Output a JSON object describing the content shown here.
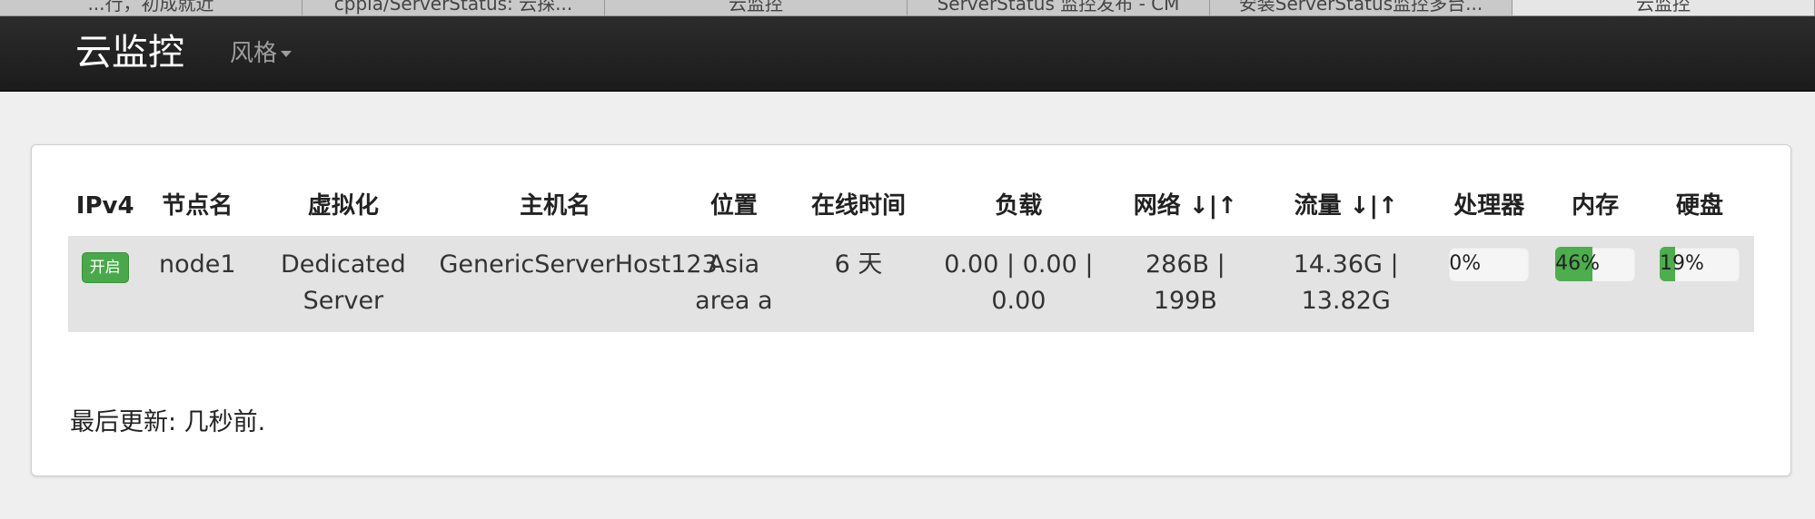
{
  "browser": {
    "tabs": [
      {
        "label": "...行，初成就近",
        "active": false
      },
      {
        "label": "cppla/ServerStatus: 云探...",
        "active": false
      },
      {
        "label": "云监控",
        "active": false
      },
      {
        "label": "ServerStatus 监控发布 - CM",
        "active": false
      },
      {
        "label": "安装ServerStatus监控多台...",
        "active": false
      },
      {
        "label": "云监控",
        "active": true
      }
    ]
  },
  "navbar": {
    "brand": "云监控",
    "style_menu": "风格"
  },
  "table": {
    "headers": {
      "ipv4": "IPv4",
      "node": "节点名",
      "virt": "虚拟化",
      "host": "主机名",
      "location": "位置",
      "uptime": "在线时间",
      "load": "负载",
      "network": "网络 ↓|↑",
      "traffic": "流量 ↓|↑",
      "cpu": "处理器",
      "memory": "内存",
      "disk": "硬盘"
    },
    "rows": [
      {
        "ipv4": "开启",
        "node": "node1",
        "virt": "Dedicated Server",
        "host": "GenericServerHost123",
        "location": "Asia area a",
        "uptime": "6 天",
        "load": "0.00 | 0.00 | 0.00",
        "network": "286B | 199B",
        "traffic": "14.36G | 13.82G",
        "cpu": {
          "label": "0%",
          "percent": 0
        },
        "memory": {
          "label": "46%",
          "percent": 46
        },
        "disk": {
          "label": "19%",
          "percent": 19
        }
      }
    ]
  },
  "footer": {
    "updated": "最后更新: 几秒前."
  },
  "colors": {
    "bar_fill": "#4cae4c",
    "badge_green": "#49a94a",
    "navbar_bg": "#222222"
  }
}
